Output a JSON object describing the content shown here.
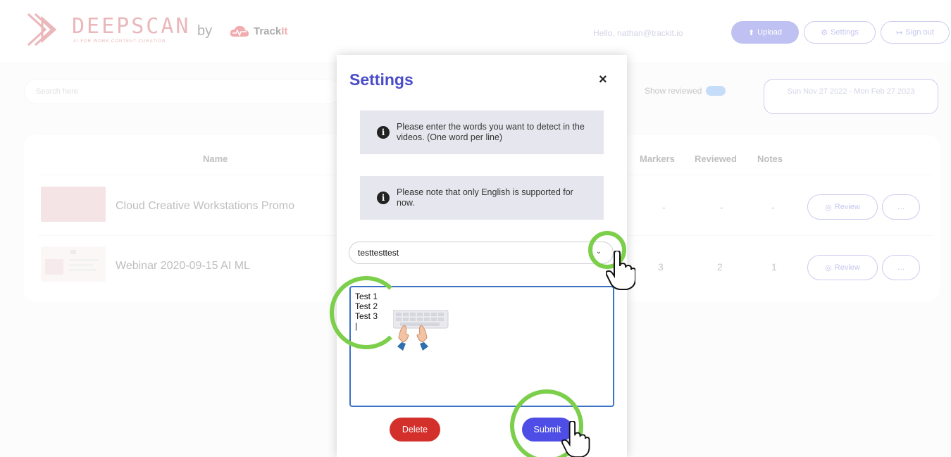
{
  "header": {
    "brand": "DEEPSCAN",
    "brand_tagline": "AI FOR WORK CONTENT CURATION",
    "by": "by",
    "partner": "Track",
    "partner_suffix": "It",
    "greeting": "Hello, nathan@trackit.io",
    "upload_label": "Upload",
    "settings_label": "Settings",
    "signout_label": "Sign out"
  },
  "toolbar": {
    "search_placeholder": "Search here",
    "show_reviewed_label": "Show reviewed",
    "date_range": "Sun Nov 27 2022 - Mon Feb 27 2023"
  },
  "table": {
    "columns": [
      "Name",
      "Markers",
      "Reviewed",
      "Notes"
    ],
    "rows": [
      {
        "name": "Cloud Creative Workstations Promo",
        "markers": "-",
        "reviewed": "-",
        "notes": "-",
        "review_label": "Review",
        "more_label": "…"
      },
      {
        "name": "Webinar 2020-09-15 AI ML",
        "markers": "3",
        "reviewed": "2",
        "notes": "1",
        "review_label": "Review",
        "more_label": "…"
      }
    ]
  },
  "modal": {
    "title": "Settings",
    "close": "×",
    "info_1": "Please enter the words you want to detect in the videos. (One word per line)",
    "info_2": "Please note that only English is supported for now.",
    "selected_list": "testtesttest",
    "words": "Test 1\nTest 2\nTest 3\n|",
    "delete_label": "Delete",
    "submit_label": "Submit"
  },
  "colors": {
    "accent": "#4e4ee6",
    "danger": "#d3302c",
    "highlight_ring": "#7ccf4a",
    "brand_red": "#c9424c"
  },
  "icons": [
    "upload-icon",
    "gear-icon",
    "signout-icon",
    "eye-icon",
    "info-icon",
    "close-icon",
    "chevron-down-icon",
    "pointer-hand-icon",
    "typing-hands-icon"
  ]
}
